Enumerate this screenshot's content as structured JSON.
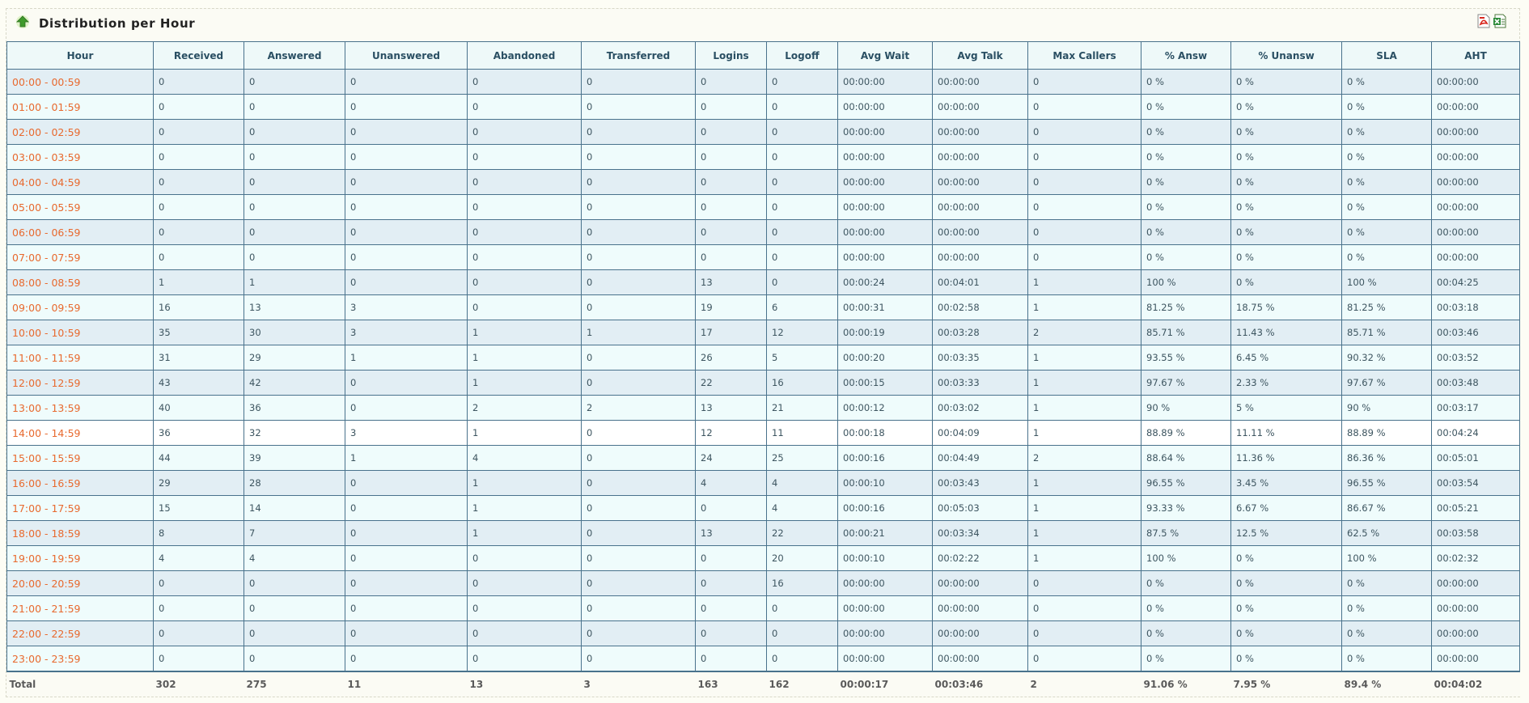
{
  "panel": {
    "title": "Distribution per Hour"
  },
  "icons": {
    "toggle": "collapse-arrow-icon",
    "pdf": "pdf-export-icon",
    "excel": "excel-export-icon"
  },
  "colors": {
    "hour_link": "#e8692e",
    "border": "#49728c",
    "header_text": "#2a4f63"
  },
  "columns": [
    "Hour",
    "Received",
    "Answered",
    "Unanswered",
    "Abandoned",
    "Transferred",
    "Logins",
    "Logoff",
    "Avg Wait",
    "Avg Talk",
    "Max Callers",
    "% Answ",
    "% Unansw",
    "SLA",
    "AHT"
  ],
  "rows": [
    [
      "00:00 - 00:59",
      "0",
      "0",
      "0",
      "0",
      "0",
      "0",
      "0",
      "00:00:00",
      "00:00:00",
      "0",
      "0 %",
      "0 %",
      "0 %",
      "00:00:00"
    ],
    [
      "01:00 - 01:59",
      "0",
      "0",
      "0",
      "0",
      "0",
      "0",
      "0",
      "00:00:00",
      "00:00:00",
      "0",
      "0 %",
      "0 %",
      "0 %",
      "00:00:00"
    ],
    [
      "02:00 - 02:59",
      "0",
      "0",
      "0",
      "0",
      "0",
      "0",
      "0",
      "00:00:00",
      "00:00:00",
      "0",
      "0 %",
      "0 %",
      "0 %",
      "00:00:00"
    ],
    [
      "03:00 - 03:59",
      "0",
      "0",
      "0",
      "0",
      "0",
      "0",
      "0",
      "00:00:00",
      "00:00:00",
      "0",
      "0 %",
      "0 %",
      "0 %",
      "00:00:00"
    ],
    [
      "04:00 - 04:59",
      "0",
      "0",
      "0",
      "0",
      "0",
      "0",
      "0",
      "00:00:00",
      "00:00:00",
      "0",
      "0 %",
      "0 %",
      "0 %",
      "00:00:00"
    ],
    [
      "05:00 - 05:59",
      "0",
      "0",
      "0",
      "0",
      "0",
      "0",
      "0",
      "00:00:00",
      "00:00:00",
      "0",
      "0 %",
      "0 %",
      "0 %",
      "00:00:00"
    ],
    [
      "06:00 - 06:59",
      "0",
      "0",
      "0",
      "0",
      "0",
      "0",
      "0",
      "00:00:00",
      "00:00:00",
      "0",
      "0 %",
      "0 %",
      "0 %",
      "00:00:00"
    ],
    [
      "07:00 - 07:59",
      "0",
      "0",
      "0",
      "0",
      "0",
      "0",
      "0",
      "00:00:00",
      "00:00:00",
      "0",
      "0 %",
      "0 %",
      "0 %",
      "00:00:00"
    ],
    [
      "08:00 - 08:59",
      "1",
      "1",
      "0",
      "0",
      "0",
      "13",
      "0",
      "00:00:24",
      "00:04:01",
      "1",
      "100 %",
      "0 %",
      "100 %",
      "00:04:25"
    ],
    [
      "09:00 - 09:59",
      "16",
      "13",
      "3",
      "0",
      "0",
      "19",
      "6",
      "00:00:31",
      "00:02:58",
      "1",
      "81.25 %",
      "18.75 %",
      "81.25 %",
      "00:03:18"
    ],
    [
      "10:00 - 10:59",
      "35",
      "30",
      "3",
      "1",
      "1",
      "17",
      "12",
      "00:00:19",
      "00:03:28",
      "2",
      "85.71 %",
      "11.43 %",
      "85.71 %",
      "00:03:46"
    ],
    [
      "11:00 - 11:59",
      "31",
      "29",
      "1",
      "1",
      "0",
      "26",
      "5",
      "00:00:20",
      "00:03:35",
      "1",
      "93.55 %",
      "6.45 %",
      "90.32 %",
      "00:03:52"
    ],
    [
      "12:00 - 12:59",
      "43",
      "42",
      "0",
      "1",
      "0",
      "22",
      "16",
      "00:00:15",
      "00:03:33",
      "1",
      "97.67 %",
      "2.33 %",
      "97.67 %",
      "00:03:48"
    ],
    [
      "13:00 - 13:59",
      "40",
      "36",
      "0",
      "2",
      "2",
      "13",
      "21",
      "00:00:12",
      "00:03:02",
      "1",
      "90 %",
      "5 %",
      "90 %",
      "00:03:17"
    ],
    [
      "14:00 - 14:59",
      "36",
      "32",
      "3",
      "1",
      "0",
      "12",
      "11",
      "00:00:18",
      "00:04:09",
      "1",
      "88.89 %",
      "11.11 %",
      "88.89 %",
      "00:04:24"
    ],
    [
      "15:00 - 15:59",
      "44",
      "39",
      "1",
      "4",
      "0",
      "24",
      "25",
      "00:00:16",
      "00:04:49",
      "2",
      "88.64 %",
      "11.36 %",
      "86.36 %",
      "00:05:01"
    ],
    [
      "16:00 - 16:59",
      "29",
      "28",
      "0",
      "1",
      "0",
      "4",
      "4",
      "00:00:10",
      "00:03:43",
      "1",
      "96.55 %",
      "3.45 %",
      "96.55 %",
      "00:03:54"
    ],
    [
      "17:00 - 17:59",
      "15",
      "14",
      "0",
      "1",
      "0",
      "0",
      "4",
      "00:00:16",
      "00:05:03",
      "1",
      "93.33 %",
      "6.67 %",
      "86.67 %",
      "00:05:21"
    ],
    [
      "18:00 - 18:59",
      "8",
      "7",
      "0",
      "1",
      "0",
      "13",
      "22",
      "00:00:21",
      "00:03:34",
      "1",
      "87.5 %",
      "12.5 %",
      "62.5 %",
      "00:03:58"
    ],
    [
      "19:00 - 19:59",
      "4",
      "4",
      "0",
      "0",
      "0",
      "0",
      "20",
      "00:00:10",
      "00:02:22",
      "1",
      "100 %",
      "0 %",
      "100 %",
      "00:02:32"
    ],
    [
      "20:00 - 20:59",
      "0",
      "0",
      "0",
      "0",
      "0",
      "0",
      "16",
      "00:00:00",
      "00:00:00",
      "0",
      "0 %",
      "0 %",
      "0 %",
      "00:00:00"
    ],
    [
      "21:00 - 21:59",
      "0",
      "0",
      "0",
      "0",
      "0",
      "0",
      "0",
      "00:00:00",
      "00:00:00",
      "0",
      "0 %",
      "0 %",
      "0 %",
      "00:00:00"
    ],
    [
      "22:00 - 22:59",
      "0",
      "0",
      "0",
      "0",
      "0",
      "0",
      "0",
      "00:00:00",
      "00:00:00",
      "0",
      "0 %",
      "0 %",
      "0 %",
      "00:00:00"
    ],
    [
      "23:00 - 23:59",
      "0",
      "0",
      "0",
      "0",
      "0",
      "0",
      "0",
      "00:00:00",
      "00:00:00",
      "0",
      "0 %",
      "0 %",
      "0 %",
      "00:00:00"
    ]
  ],
  "highlighted_row": 14,
  "totals": [
    "Total",
    "302",
    "275",
    "11",
    "13",
    "3",
    "163",
    "162",
    "00:00:17",
    "00:03:46",
    "2",
    "91.06 %",
    "7.95 %",
    "89.4 %",
    "00:04:02"
  ]
}
